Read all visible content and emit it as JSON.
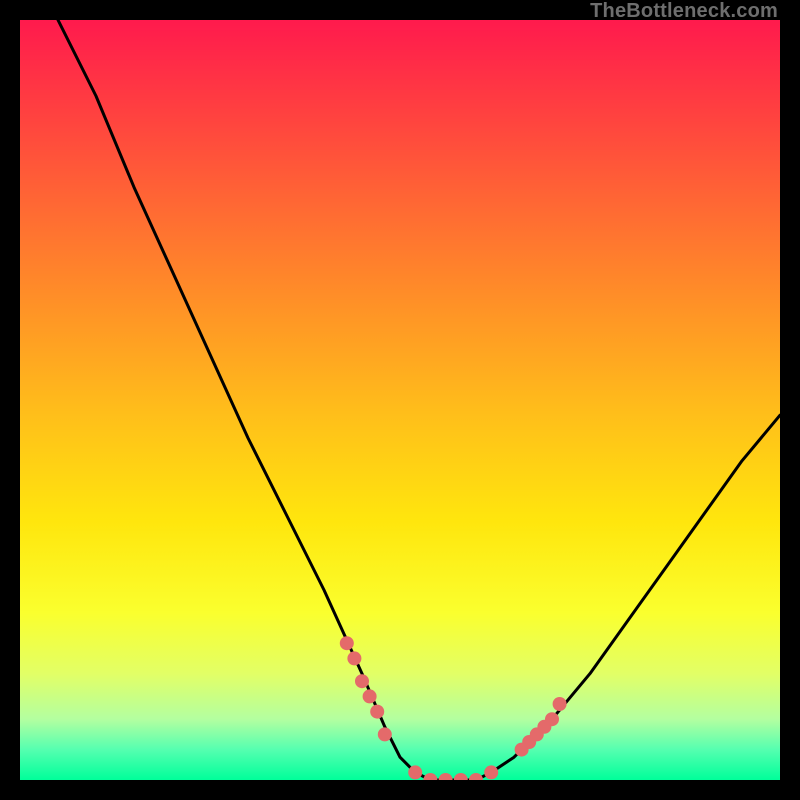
{
  "watermark": "TheBottleneck.com",
  "colors": {
    "background": "#000000",
    "gradient_top": "#ff1a4d",
    "gradient_bottom": "#00ff9a",
    "curve": "#000000",
    "dot": "#e46a6a"
  },
  "chart_data": {
    "type": "line",
    "title": "",
    "xlabel": "",
    "ylabel": "",
    "xlim": [
      0,
      100
    ],
    "ylim": [
      0,
      100
    ],
    "series": [
      {
        "name": "bottleneck-curve",
        "x": [
          5,
          10,
          15,
          20,
          25,
          30,
          35,
          40,
          45,
          48,
          50,
          52,
          54,
          56,
          58,
          60,
          62,
          65,
          70,
          75,
          80,
          85,
          90,
          95,
          100
        ],
        "y": [
          100,
          90,
          78,
          67,
          56,
          45,
          35,
          25,
          14,
          7,
          3,
          1,
          0,
          0,
          0,
          0,
          1,
          3,
          8,
          14,
          21,
          28,
          35,
          42,
          48
        ]
      }
    ],
    "highlight_dots": {
      "name": "marked-range",
      "points": [
        {
          "x": 43,
          "y": 18
        },
        {
          "x": 44,
          "y": 16
        },
        {
          "x": 45,
          "y": 13
        },
        {
          "x": 46,
          "y": 11
        },
        {
          "x": 47,
          "y": 9
        },
        {
          "x": 48,
          "y": 6
        },
        {
          "x": 52,
          "y": 1
        },
        {
          "x": 54,
          "y": 0
        },
        {
          "x": 56,
          "y": 0
        },
        {
          "x": 58,
          "y": 0
        },
        {
          "x": 60,
          "y": 0
        },
        {
          "x": 62,
          "y": 1
        },
        {
          "x": 66,
          "y": 4
        },
        {
          "x": 67,
          "y": 5
        },
        {
          "x": 68,
          "y": 6
        },
        {
          "x": 69,
          "y": 7
        },
        {
          "x": 70,
          "y": 8
        },
        {
          "x": 71,
          "y": 10
        }
      ]
    }
  }
}
